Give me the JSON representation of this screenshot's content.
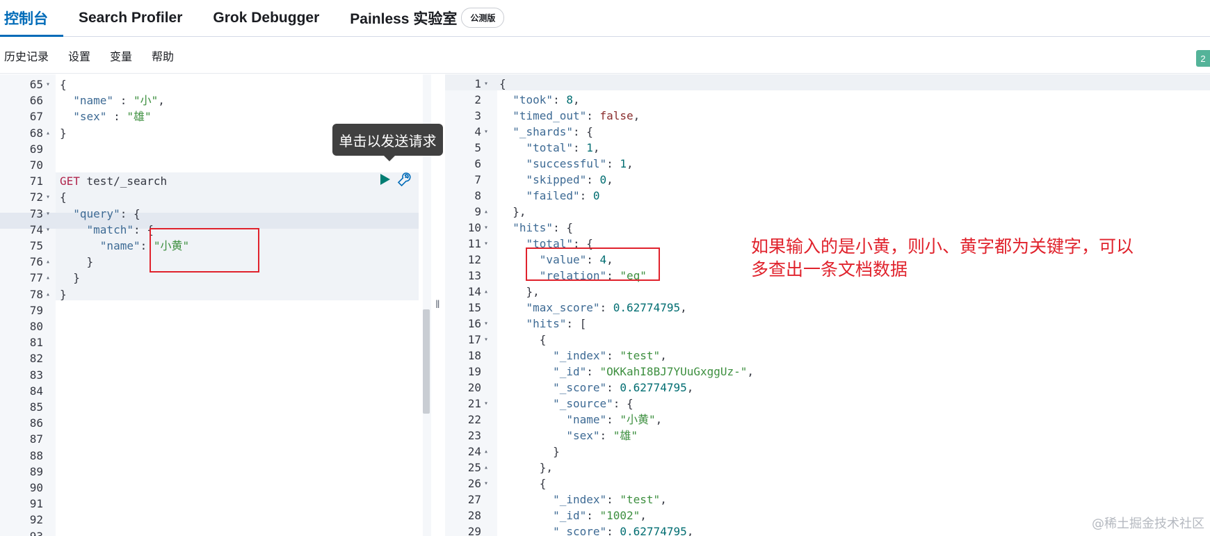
{
  "tabs": [
    {
      "label": "控制台"
    },
    {
      "label": "Search Profiler"
    },
    {
      "label": "Grok Debugger"
    },
    {
      "label": "Painless 实验室"
    }
  ],
  "beta_badge": "公测版",
  "submenu": {
    "history": "历史记录",
    "settings": "设置",
    "variables": "变量",
    "help": "帮助",
    "right_badge": "2"
  },
  "tooltip": "单击以发送请求",
  "annotation_line1": "如果输入的是小黄，则小、黄字都为关键字，可以",
  "annotation_line2": "多查出一条文档数据",
  "watermark": "@稀土掘金技术社区",
  "left_lines": [
    {
      "n": "65",
      "fold": "▾",
      "code": [
        [
          "p",
          "{"
        ]
      ]
    },
    {
      "n": "66",
      "fold": "",
      "code": [
        [
          "p",
          "  "
        ],
        [
          "k",
          "\"name\""
        ],
        [
          "p",
          " : "
        ],
        [
          "s",
          "\"小\""
        ],
        [
          "p",
          ","
        ]
      ]
    },
    {
      "n": "67",
      "fold": "",
      "code": [
        [
          "p",
          "  "
        ],
        [
          "k",
          "\"sex\""
        ],
        [
          "p",
          " : "
        ],
        [
          "s",
          "\"雄\""
        ]
      ]
    },
    {
      "n": "68",
      "fold": "▴",
      "code": [
        [
          "p",
          "}"
        ]
      ]
    },
    {
      "n": "69",
      "fold": "",
      "code": []
    },
    {
      "n": "70",
      "fold": "",
      "code": []
    },
    {
      "n": "71",
      "fold": "",
      "code": [
        [
          "kw",
          "GET"
        ],
        [
          "p",
          " test/_search"
        ]
      ]
    },
    {
      "n": "72",
      "fold": "▾",
      "code": [
        [
          "p",
          "{"
        ]
      ]
    },
    {
      "n": "73",
      "fold": "▾",
      "code": [
        [
          "p",
          "  "
        ],
        [
          "k",
          "\"query\""
        ],
        [
          "p",
          ": {"
        ]
      ]
    },
    {
      "n": "74",
      "fold": "▾",
      "code": [
        [
          "p",
          "    "
        ],
        [
          "k",
          "\"match\""
        ],
        [
          "p",
          ": {"
        ]
      ]
    },
    {
      "n": "75",
      "fold": "",
      "code": [
        [
          "p",
          "      "
        ],
        [
          "k",
          "\"name\""
        ],
        [
          "p",
          ": "
        ],
        [
          "s",
          "\"小黄\""
        ]
      ]
    },
    {
      "n": "76",
      "fold": "▴",
      "code": [
        [
          "p",
          "    }"
        ]
      ]
    },
    {
      "n": "77",
      "fold": "▴",
      "code": [
        [
          "p",
          "  }"
        ]
      ]
    },
    {
      "n": "78",
      "fold": "▴",
      "code": [
        [
          "p",
          "}"
        ]
      ]
    },
    {
      "n": "79",
      "fold": "",
      "code": []
    },
    {
      "n": "80",
      "fold": "",
      "code": []
    },
    {
      "n": "81",
      "fold": "",
      "code": []
    },
    {
      "n": "82",
      "fold": "",
      "code": []
    },
    {
      "n": "83",
      "fold": "",
      "code": []
    },
    {
      "n": "84",
      "fold": "",
      "code": []
    },
    {
      "n": "85",
      "fold": "",
      "code": []
    },
    {
      "n": "86",
      "fold": "",
      "code": []
    },
    {
      "n": "87",
      "fold": "",
      "code": []
    },
    {
      "n": "88",
      "fold": "",
      "code": []
    },
    {
      "n": "89",
      "fold": "",
      "code": []
    },
    {
      "n": "90",
      "fold": "",
      "code": []
    },
    {
      "n": "91",
      "fold": "",
      "code": []
    },
    {
      "n": "92",
      "fold": "",
      "code": []
    },
    {
      "n": "93",
      "fold": "",
      "code": []
    }
  ],
  "right_lines": [
    {
      "n": "1",
      "fold": "▾",
      "code": [
        [
          "p",
          "{"
        ]
      ]
    },
    {
      "n": "2",
      "fold": "",
      "code": [
        [
          "p",
          "  "
        ],
        [
          "k",
          "\"took\""
        ],
        [
          "p",
          ": "
        ],
        [
          "n",
          "8"
        ],
        [
          "p",
          ","
        ]
      ]
    },
    {
      "n": "3",
      "fold": "",
      "code": [
        [
          "p",
          "  "
        ],
        [
          "k",
          "\"timed_out\""
        ],
        [
          "p",
          ": "
        ],
        [
          "b",
          "false"
        ],
        [
          "p",
          ","
        ]
      ]
    },
    {
      "n": "4",
      "fold": "▾",
      "code": [
        [
          "p",
          "  "
        ],
        [
          "k",
          "\"_shards\""
        ],
        [
          "p",
          ": {"
        ]
      ]
    },
    {
      "n": "5",
      "fold": "",
      "code": [
        [
          "p",
          "    "
        ],
        [
          "k",
          "\"total\""
        ],
        [
          "p",
          ": "
        ],
        [
          "n",
          "1"
        ],
        [
          "p",
          ","
        ]
      ]
    },
    {
      "n": "6",
      "fold": "",
      "code": [
        [
          "p",
          "    "
        ],
        [
          "k",
          "\"successful\""
        ],
        [
          "p",
          ": "
        ],
        [
          "n",
          "1"
        ],
        [
          "p",
          ","
        ]
      ]
    },
    {
      "n": "7",
      "fold": "",
      "code": [
        [
          "p",
          "    "
        ],
        [
          "k",
          "\"skipped\""
        ],
        [
          "p",
          ": "
        ],
        [
          "n",
          "0"
        ],
        [
          "p",
          ","
        ]
      ]
    },
    {
      "n": "8",
      "fold": "",
      "code": [
        [
          "p",
          "    "
        ],
        [
          "k",
          "\"failed\""
        ],
        [
          "p",
          ": "
        ],
        [
          "n",
          "0"
        ]
      ]
    },
    {
      "n": "9",
      "fold": "▴",
      "code": [
        [
          "p",
          "  },"
        ]
      ]
    },
    {
      "n": "10",
      "fold": "▾",
      "code": [
        [
          "p",
          "  "
        ],
        [
          "k",
          "\"hits\""
        ],
        [
          "p",
          ": {"
        ]
      ]
    },
    {
      "n": "11",
      "fold": "▾",
      "code": [
        [
          "p",
          "    "
        ],
        [
          "k",
          "\"total\""
        ],
        [
          "p",
          ": {"
        ]
      ]
    },
    {
      "n": "12",
      "fold": "",
      "code": [
        [
          "p",
          "      "
        ],
        [
          "k",
          "\"value\""
        ],
        [
          "p",
          ": "
        ],
        [
          "n",
          "4"
        ],
        [
          "p",
          ","
        ]
      ]
    },
    {
      "n": "13",
      "fold": "",
      "code": [
        [
          "p",
          "      "
        ],
        [
          "k",
          "\"relation\""
        ],
        [
          "p",
          ": "
        ],
        [
          "s",
          "\"eq\""
        ]
      ]
    },
    {
      "n": "14",
      "fold": "▴",
      "code": [
        [
          "p",
          "    },"
        ]
      ]
    },
    {
      "n": "15",
      "fold": "",
      "code": [
        [
          "p",
          "    "
        ],
        [
          "k",
          "\"max_score\""
        ],
        [
          "p",
          ": "
        ],
        [
          "n",
          "0.62774795"
        ],
        [
          "p",
          ","
        ]
      ]
    },
    {
      "n": "16",
      "fold": "▾",
      "code": [
        [
          "p",
          "    "
        ],
        [
          "k",
          "\"hits\""
        ],
        [
          "p",
          ": ["
        ]
      ]
    },
    {
      "n": "17",
      "fold": "▾",
      "code": [
        [
          "p",
          "      {"
        ]
      ]
    },
    {
      "n": "18",
      "fold": "",
      "code": [
        [
          "p",
          "        "
        ],
        [
          "k",
          "\"_index\""
        ],
        [
          "p",
          ": "
        ],
        [
          "s",
          "\"test\""
        ],
        [
          "p",
          ","
        ]
      ]
    },
    {
      "n": "19",
      "fold": "",
      "code": [
        [
          "p",
          "        "
        ],
        [
          "k",
          "\"_id\""
        ],
        [
          "p",
          ": "
        ],
        [
          "s",
          "\"OKKahI8BJ7YUuGxggUz-\""
        ],
        [
          "p",
          ","
        ]
      ]
    },
    {
      "n": "20",
      "fold": "",
      "code": [
        [
          "p",
          "        "
        ],
        [
          "k",
          "\"_score\""
        ],
        [
          "p",
          ": "
        ],
        [
          "n",
          "0.62774795"
        ],
        [
          "p",
          ","
        ]
      ]
    },
    {
      "n": "21",
      "fold": "▾",
      "code": [
        [
          "p",
          "        "
        ],
        [
          "k",
          "\"_source\""
        ],
        [
          "p",
          ": {"
        ]
      ]
    },
    {
      "n": "22",
      "fold": "",
      "code": [
        [
          "p",
          "          "
        ],
        [
          "k",
          "\"name\""
        ],
        [
          "p",
          ": "
        ],
        [
          "s",
          "\"小黄\""
        ],
        [
          "p",
          ","
        ]
      ]
    },
    {
      "n": "23",
      "fold": "",
      "code": [
        [
          "p",
          "          "
        ],
        [
          "k",
          "\"sex\""
        ],
        [
          "p",
          ": "
        ],
        [
          "s",
          "\"雄\""
        ]
      ]
    },
    {
      "n": "24",
      "fold": "▴",
      "code": [
        [
          "p",
          "        }"
        ]
      ]
    },
    {
      "n": "25",
      "fold": "▴",
      "code": [
        [
          "p",
          "      },"
        ]
      ]
    },
    {
      "n": "26",
      "fold": "▾",
      "code": [
        [
          "p",
          "      {"
        ]
      ]
    },
    {
      "n": "27",
      "fold": "",
      "code": [
        [
          "p",
          "        "
        ],
        [
          "k",
          "\"_index\""
        ],
        [
          "p",
          ": "
        ],
        [
          "s",
          "\"test\""
        ],
        [
          "p",
          ","
        ]
      ]
    },
    {
      "n": "28",
      "fold": "",
      "code": [
        [
          "p",
          "        "
        ],
        [
          "k",
          "\"_id\""
        ],
        [
          "p",
          ": "
        ],
        [
          "s",
          "\"1002\""
        ],
        [
          "p",
          ","
        ]
      ]
    },
    {
      "n": "29",
      "fold": "",
      "code": [
        [
          "p",
          "        "
        ],
        [
          "k",
          "\"_score\""
        ],
        [
          "p",
          ": "
        ],
        [
          "n",
          "0.62774795"
        ],
        [
          "p",
          ","
        ]
      ]
    }
  ]
}
